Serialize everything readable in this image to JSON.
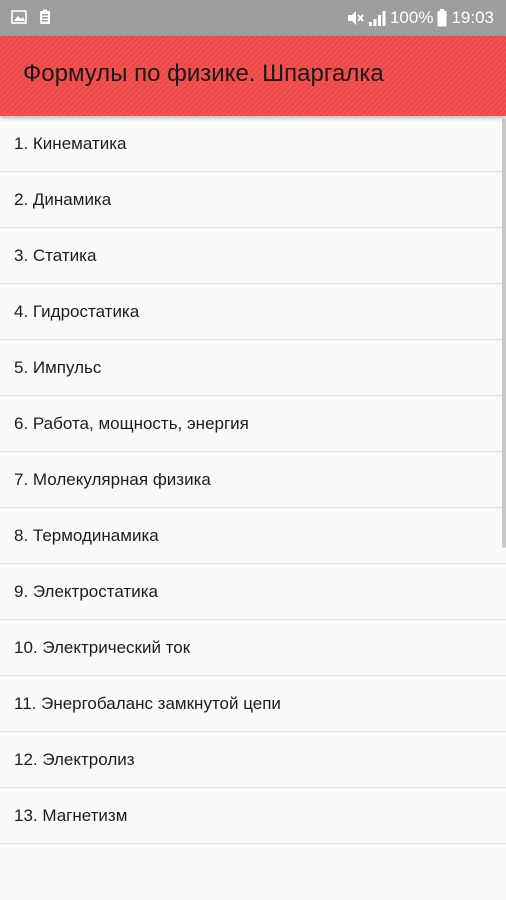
{
  "status_bar": {
    "battery_percent": "100%",
    "time": "19:03",
    "icons": [
      "image-icon",
      "battery-saver-icon",
      "mute-icon",
      "signal-icon",
      "battery-icon"
    ]
  },
  "app_bar": {
    "title": "Формулы по физике. Шпаргалка",
    "color": "#f44a4a"
  },
  "list": {
    "items": [
      "1. Кинематика",
      "2. Динамика",
      "3. Статика",
      "4. Гидростатика",
      "5. Импульс",
      "6. Работа, мощность, энергия",
      "7. Молекулярная физика",
      "8. Термодинамика",
      "9. Электростатика",
      "10. Электрический ток",
      "11. Энергобаланс замкнутой цепи",
      "12. Электролиз",
      "13. Магнетизм"
    ]
  }
}
